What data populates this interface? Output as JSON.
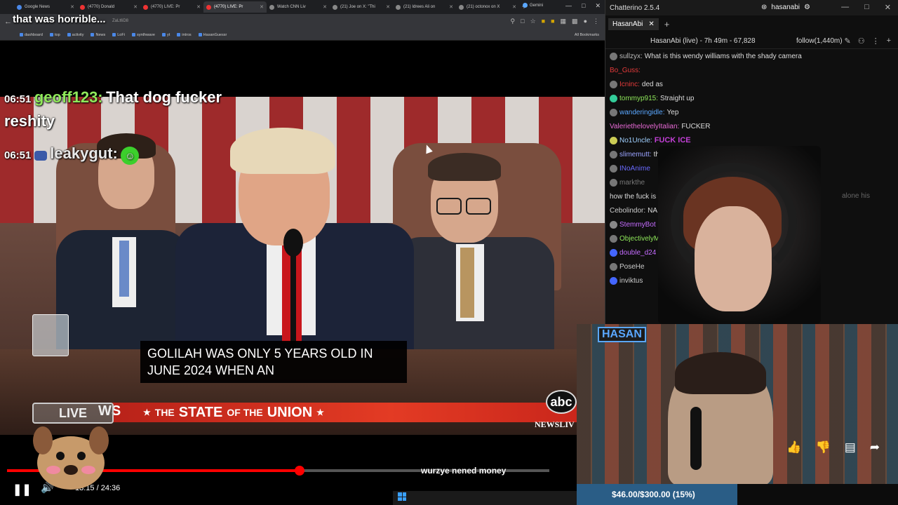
{
  "browser": {
    "tabs": [
      {
        "label": "Google News",
        "color": "#4a88e8"
      },
      {
        "label": "(4770) Donald",
        "color": "#e33"
      },
      {
        "label": "(4770) LIVE: Pr",
        "color": "#e33"
      },
      {
        "label": "(4770) LIVE: Pr",
        "color": "#e33",
        "active": true
      },
      {
        "label": "Watch CNN Liv",
        "color": "#888"
      },
      {
        "label": "(21) Joe on X: \"Thi",
        "color": "#888"
      },
      {
        "label": "(21) Idrees Ali on",
        "color": "#888"
      },
      {
        "label": "(21) octonox on X",
        "color": "#888"
      }
    ],
    "gemini_tab": "Gemini",
    "url": "ZaLt6D8",
    "bookmarks": [
      "dashboard",
      "top",
      "activity",
      "News",
      "LoFi",
      "synthwave",
      "yt",
      "intros",
      "HasanGuessr"
    ],
    "all_bookmarks": "All Bookmarks"
  },
  "overlay_title": "that was horrible...",
  "video_chat": [
    {
      "time": "06:51",
      "user": "geoff123:",
      "message": "That dog fucker",
      "message2": "reshity"
    },
    {
      "time": "06:51",
      "user": "leakygut:",
      "message": ""
    }
  ],
  "captions": [
    "GOLILAH WAS ONLY 5 YEARS OLD IN",
    "JUNE 2024 WHEN AN"
  ],
  "lower_third": {
    "prefix": "WS",
    "small": "THE",
    "title": "STATE",
    "mid": "OF THE",
    "end": "UNION"
  },
  "network": {
    "logo": "abc",
    "sub": "NEWSLIV"
  },
  "live_box": "LIVE",
  "player": {
    "time": "13:15 / 24:36",
    "progress": 0.539
  },
  "bar_label": "wurzye nened money",
  "chatterino": {
    "title": "Chatterino 2.5.4",
    "user": "hasanabi",
    "tab": "HasanAbi",
    "channel_info": "HasanAbi (live) - 7h 49m - 67,828",
    "follow": "follow(1,440m)",
    "messages": [
      {
        "user": "sullzyx:",
        "text": "What is this wendy williams with the shady camera",
        "color": "#bbbbbb",
        "badge": "#777"
      },
      {
        "user": "Bo_Guss:",
        "text": "",
        "color": "#e33a3a",
        "badge": ""
      },
      {
        "user": "Icninc:",
        "text": "ded as",
        "color": "#e33a3a",
        "badge": "#777"
      },
      {
        "user": "tommyp915:",
        "text": "Straight up",
        "color": "#8fe85a",
        "badge": "#3c9"
      },
      {
        "user": "wanderingidle:",
        "text": "Yep",
        "color": "#5aa7ff",
        "badge": "#777"
      },
      {
        "user": "ValeriethelovelyItalian:",
        "text": "FUCKER",
        "color": "#e86ad6",
        "badge": ""
      },
      {
        "user": "No1Uncle:",
        "text": "FUCK ICE",
        "color": "#a0d0ff",
        "badge": "#cc5",
        "special": true
      },
      {
        "user": "slimemutt:",
        "text": "this",
        "color": "#9aa3ff",
        "badge": "#777"
      },
      {
        "user": "INoAnime",
        "text": "",
        "color": "#6a6aff",
        "badge": "#777"
      },
      {
        "user": "markthe",
        "text": "",
        "color": "#777",
        "badge": "#777"
      },
      {
        "user": "",
        "text": "how the fuck is",
        "color": "#ccc",
        "badge": ""
      },
      {
        "user": "Cebolindor:",
        "text": "NA",
        "color": "#ccc",
        "badge": ""
      },
      {
        "user": "StemmyBot",
        "text": "",
        "color": "#c56cff",
        "badge": "#888"
      },
      {
        "user": "ObjectivelyM",
        "text": "",
        "color": "#8fe85a",
        "badge": "#777"
      },
      {
        "user": "double_d24",
        "text": "",
        "color": "#c56cff",
        "badge": "#4466ff"
      },
      {
        "user": "PoseHe",
        "text": "",
        "color": "#ccc",
        "badge": "#777"
      },
      {
        "user": "inviktus",
        "text": "",
        "color": "#ccc",
        "badge": "#4466ff"
      }
    ],
    "alone_text": "alone his"
  },
  "stream_logo": "HASAN",
  "goal": {
    "text": "$46.00/$300.00 (15%)",
    "fraction": 0.15
  }
}
